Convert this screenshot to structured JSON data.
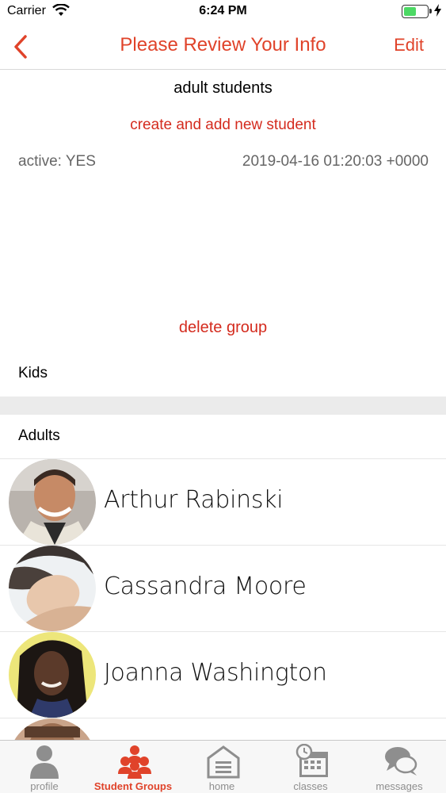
{
  "status_bar": {
    "carrier": "Carrier",
    "time": "6:24 PM",
    "battery_level": 0.55
  },
  "nav": {
    "title": "Please Review Your Info",
    "edit_label": "Edit"
  },
  "group": {
    "name": "adult students",
    "add_student_label": "create and add new student",
    "active_label": "active: YES",
    "created_at": "2019-04-16 01:20:03 +0000",
    "delete_label": "delete group"
  },
  "groups": [
    {
      "label": "Kids"
    },
    {
      "label": "Adults"
    }
  ],
  "students": [
    {
      "name": "Arthur Rabinski"
    },
    {
      "name": "Cassandra Moore"
    },
    {
      "name": "Joanna Washington"
    }
  ],
  "tabs": [
    {
      "label": "profile",
      "icon": "person-icon"
    },
    {
      "label": "Student Groups",
      "icon": "group-icon",
      "active": true
    },
    {
      "label": "home",
      "icon": "home-icon"
    },
    {
      "label": "classes",
      "icon": "calendar-icon"
    },
    {
      "label": "messages",
      "icon": "chat-icon"
    }
  ],
  "colors": {
    "accent": "#e0432a",
    "link_red": "#d42b1e",
    "inactive_tab": "#8e8e8e"
  }
}
